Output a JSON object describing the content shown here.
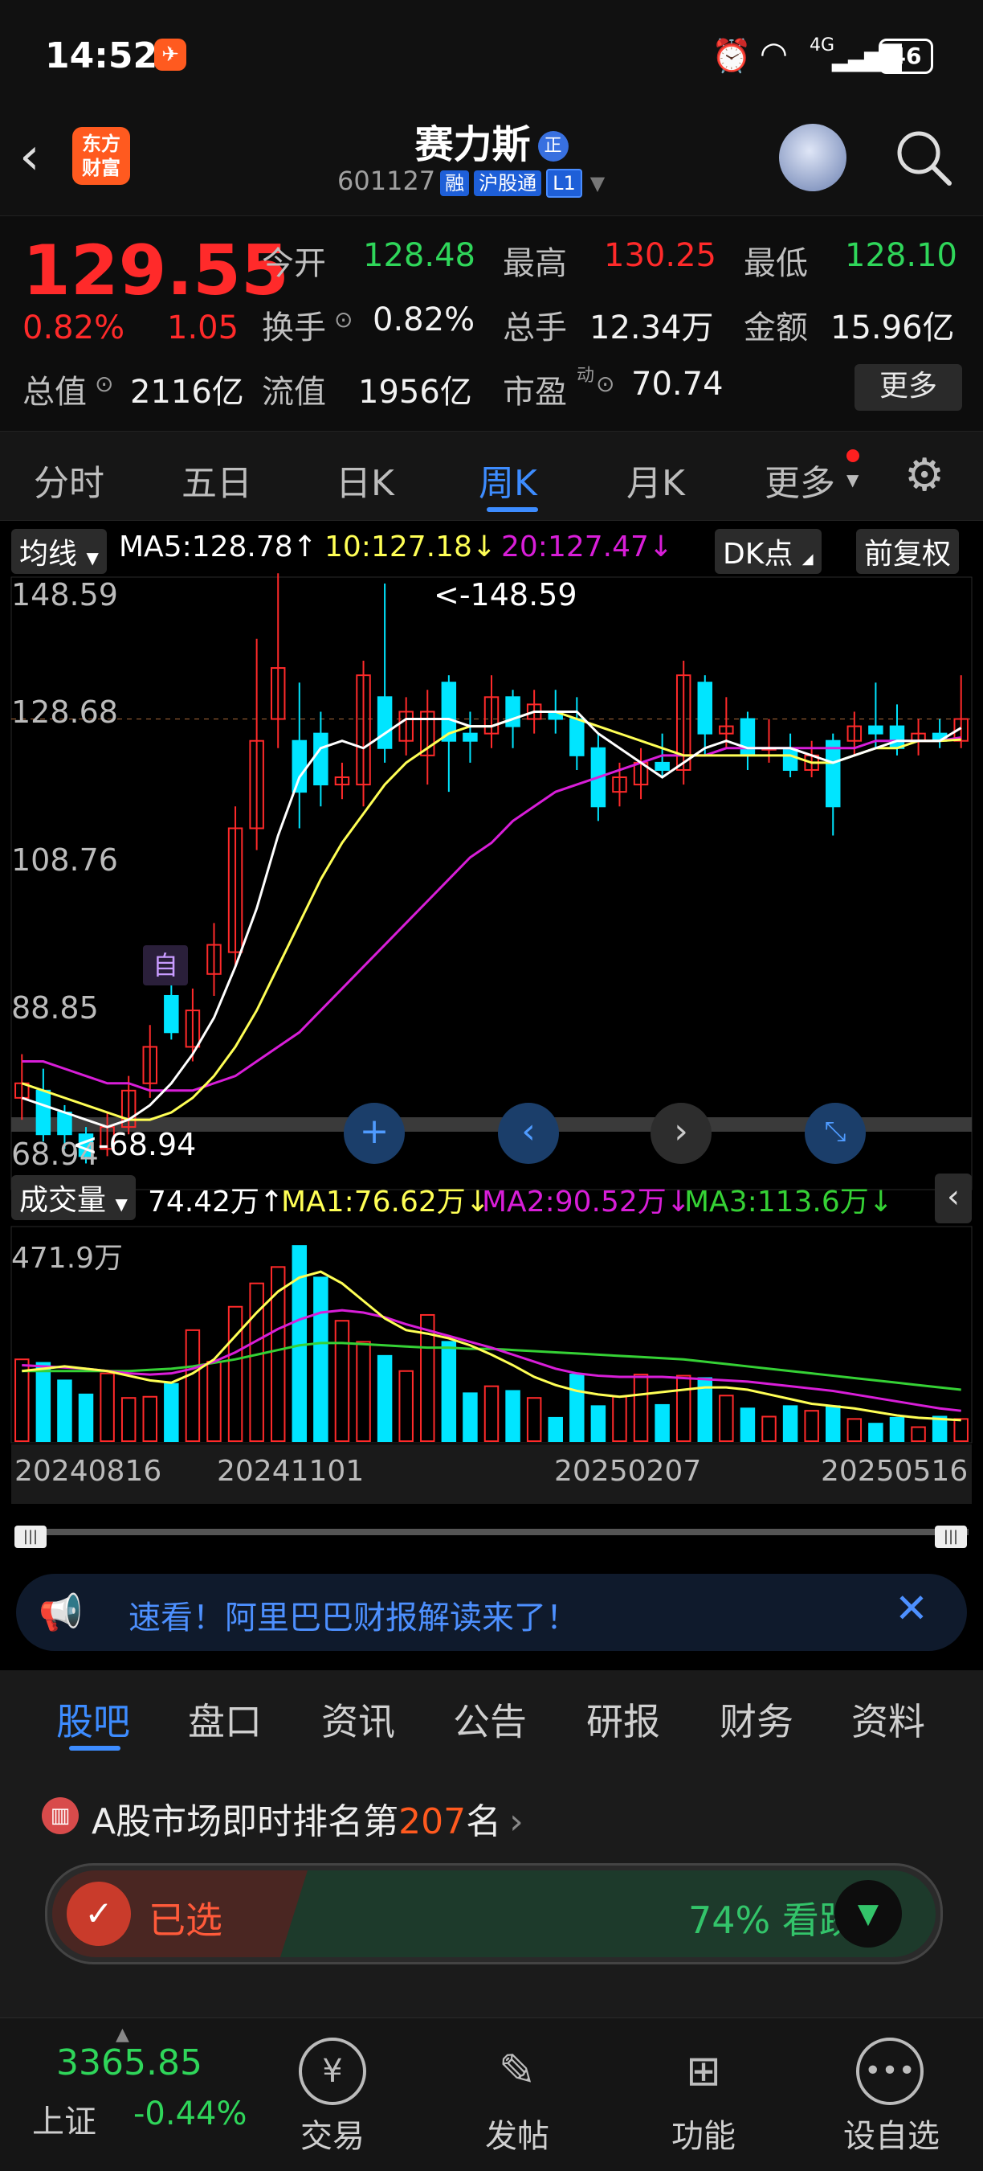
{
  "status_bar": {
    "time": "14:52",
    "network": "4G",
    "battery": "46"
  },
  "header": {
    "logo_line1": "东方",
    "logo_line2": "财富",
    "title": "赛力斯",
    "title_badge": "正",
    "code": "601127",
    "badges": [
      "融",
      "沪股通",
      "L1"
    ]
  },
  "quote": {
    "price": "129.55",
    "change_pct": "0.82%",
    "change": "1.05",
    "open_label": "今开",
    "open": "128.48",
    "high_label": "最高",
    "high": "130.25",
    "low_label": "最低",
    "low": "128.10",
    "turnover_label": "换手",
    "turnover": "0.82%",
    "volume_label": "总手",
    "volume": "12.34万",
    "amount_label": "金额",
    "amount": "15.96亿",
    "mktcap_label": "总值",
    "mktcap": "2116亿",
    "float_label": "流值",
    "float": "1956亿",
    "pe_label": "市盈",
    "pe_sup": "动",
    "pe": "70.74",
    "more_button": "更多"
  },
  "tabs": [
    "分时",
    "五日",
    "日K",
    "周K",
    "月K",
    "更多"
  ],
  "active_tab": "周K",
  "chart": {
    "indicator_select": "均线",
    "ma5": "MA5:128.78↑",
    "ma10": "10:127.18↓",
    "ma20": "20:127.47↓",
    "dk_button": "DK点",
    "fq_button": "前复权",
    "y_labels": [
      "148.59",
      "128.68",
      "108.76",
      "88.85",
      "68.94"
    ],
    "high_note": "<-148.59",
    "low_note": "<-68.94",
    "auto_marker": "自",
    "vol_select": "成交量",
    "vol_value": "74.42万↑",
    "vol_ma1": "MA1:76.62万↓",
    "vol_ma2": "MA2:90.52万↓",
    "vol_ma3": "MA3:113.6万↓",
    "vol_top": "471.9万",
    "dates": [
      "20240816",
      "20241101",
      "20250207",
      "20250516"
    ],
    "colors": {
      "up": "#ff2a2a",
      "down": "#00e5ff",
      "ma5": "#ffffff",
      "ma10": "#ffff55",
      "ma20": "#d81ed8",
      "ma3": "#35d135"
    }
  },
  "chart_data": {
    "type": "candlestick",
    "ylim": [
      68.94,
      148.59
    ],
    "series": [
      {
        "o": 78,
        "c": 80,
        "h": 84,
        "l": 75
      },
      {
        "o": 79,
        "c": 73,
        "h": 82,
        "l": 72
      },
      {
        "o": 76,
        "c": 73,
        "h": 77,
        "l": 71
      },
      {
        "o": 73,
        "c": 70,
        "h": 74,
        "l": 69
      },
      {
        "o": 71,
        "c": 74,
        "h": 76,
        "l": 70
      },
      {
        "o": 74,
        "c": 79,
        "h": 81,
        "l": 73
      },
      {
        "o": 80,
        "c": 85,
        "h": 88,
        "l": 78
      },
      {
        "o": 92,
        "c": 87,
        "h": 95,
        "l": 86
      },
      {
        "o": 85,
        "c": 90,
        "h": 93,
        "l": 83
      },
      {
        "o": 95,
        "c": 99,
        "h": 102,
        "l": 92
      },
      {
        "o": 98,
        "c": 115,
        "h": 118,
        "l": 96
      },
      {
        "o": 115,
        "c": 127,
        "h": 141,
        "l": 112
      },
      {
        "o": 130,
        "c": 137,
        "h": 150,
        "l": 126
      },
      {
        "o": 127,
        "c": 120,
        "h": 135,
        "l": 115
      },
      {
        "o": 128,
        "c": 121,
        "h": 131,
        "l": 118
      },
      {
        "o": 121,
        "c": 122,
        "h": 124,
        "l": 119
      },
      {
        "o": 121,
        "c": 136,
        "h": 138,
        "l": 118
      },
      {
        "o": 133,
        "c": 126,
        "h": 148.59,
        "l": 124
      },
      {
        "o": 127,
        "c": 131,
        "h": 133,
        "l": 125
      },
      {
        "o": 125,
        "c": 131,
        "h": 134,
        "l": 121
      },
      {
        "o": 135,
        "c": 127,
        "h": 136,
        "l": 120
      },
      {
        "o": 128,
        "c": 127,
        "h": 131,
        "l": 124
      },
      {
        "o": 128,
        "c": 133,
        "h": 136,
        "l": 126
      },
      {
        "o": 133,
        "c": 129,
        "h": 134,
        "l": 126
      },
      {
        "o": 130,
        "c": 132,
        "h": 134,
        "l": 128
      },
      {
        "o": 131,
        "c": 130,
        "h": 134,
        "l": 128
      },
      {
        "o": 130,
        "c": 125,
        "h": 133,
        "l": 123
      },
      {
        "o": 126,
        "c": 118,
        "h": 128,
        "l": 116
      },
      {
        "o": 120,
        "c": 122,
        "h": 124,
        "l": 118
      },
      {
        "o": 121,
        "c": 124,
        "h": 126,
        "l": 119
      },
      {
        "o": 124,
        "c": 123,
        "h": 128,
        "l": 122
      },
      {
        "o": 123,
        "c": 136,
        "h": 138,
        "l": 121
      },
      {
        "o": 135,
        "c": 128,
        "h": 136,
        "l": 125
      },
      {
        "o": 128,
        "c": 129,
        "h": 133,
        "l": 126
      },
      {
        "o": 130,
        "c": 125,
        "h": 131,
        "l": 123
      },
      {
        "o": 126,
        "c": 126,
        "h": 130,
        "l": 124
      },
      {
        "o": 126,
        "c": 123,
        "h": 128,
        "l": 122
      },
      {
        "o": 123,
        "c": 125,
        "h": 127,
        "l": 122
      },
      {
        "o": 127,
        "c": 118,
        "h": 128,
        "l": 114
      },
      {
        "o": 127,
        "c": 129,
        "h": 131,
        "l": 125
      },
      {
        "o": 129,
        "c": 128,
        "h": 135,
        "l": 126
      },
      {
        "o": 129,
        "c": 126,
        "h": 132,
        "l": 125
      },
      {
        "o": 127,
        "c": 128,
        "h": 130,
        "l": 125
      },
      {
        "o": 128,
        "c": 127,
        "h": 130,
        "l": 126
      },
      {
        "o": 127,
        "c": 130,
        "h": 136,
        "l": 126
      }
    ],
    "ma5": [
      78,
      77,
      76,
      75,
      74,
      75,
      77,
      80,
      84,
      89,
      96,
      104,
      114,
      122,
      126,
      127,
      126,
      128,
      130,
      130,
      130,
      129,
      129,
      130,
      131,
      131,
      131,
      128,
      126,
      124,
      122,
      124,
      126,
      127,
      126,
      126,
      126,
      125,
      124,
      125,
      126,
      127,
      127,
      127,
      128.78
    ],
    "ma10": [
      80,
      79,
      78,
      77,
      76,
      75,
      75,
      76,
      78,
      81,
      85,
      90,
      96,
      102,
      108,
      113,
      117,
      121,
      124,
      126,
      128,
      129,
      129,
      130,
      131,
      131,
      130,
      129,
      128,
      127,
      126,
      125,
      125,
      125,
      125,
      125,
      125,
      124,
      124,
      125,
      126,
      126,
      127,
      127,
      127.18
    ],
    "ma20": [
      83,
      83,
      82,
      81,
      80,
      80,
      79,
      79,
      79,
      80,
      81,
      83,
      85,
      87,
      90,
      93,
      96,
      99,
      102,
      105,
      108,
      111,
      113,
      116,
      118,
      120,
      121,
      122,
      123,
      124,
      125,
      125,
      125,
      126,
      126,
      126,
      126,
      126,
      126,
      126,
      127,
      127,
      127,
      127,
      127.47
    ],
    "volume": [
      70,
      67,
      52,
      40,
      58,
      37,
      38,
      49,
      95,
      68,
      115,
      135,
      149,
      167,
      140,
      103,
      85,
      73,
      60,
      108,
      85,
      41,
      47,
      43,
      37,
      20,
      57,
      30,
      38,
      57,
      31,
      56,
      54,
      39,
      28,
      21,
      30,
      26,
      30,
      19,
      15,
      20,
      12,
      21,
      19
    ],
    "vol_ma1": [
      60,
      62,
      64,
      62,
      60,
      56,
      52,
      50,
      58,
      70,
      90,
      110,
      128,
      140,
      145,
      135,
      120,
      105,
      95,
      92,
      88,
      82,
      74,
      65,
      55,
      48,
      43,
      40,
      38,
      40,
      42,
      44,
      46,
      46,
      44,
      40,
      36,
      32,
      30,
      28,
      25,
      22,
      20,
      19,
      18
    ],
    "vol_ma2": [
      65,
      64,
      63,
      62,
      60,
      58,
      57,
      58,
      62,
      68,
      76,
      86,
      96,
      104,
      110,
      112,
      110,
      106,
      100,
      95,
      90,
      85,
      80,
      74,
      68,
      62,
      58,
      56,
      55,
      55,
      55,
      54,
      53,
      52,
      51,
      49,
      47,
      45,
      43,
      40,
      37,
      34,
      31,
      28,
      26
    ],
    "vol_ma3": [
      60,
      60,
      60,
      60,
      60,
      60,
      61,
      62,
      64,
      67,
      70,
      74,
      78,
      82,
      84,
      84,
      83,
      82,
      81,
      80,
      80,
      79,
      79,
      78,
      77,
      76,
      75,
      74,
      73,
      72,
      71,
      70,
      68,
      66,
      64,
      62,
      60,
      58,
      56,
      54,
      52,
      50,
      48,
      46,
      44
    ]
  },
  "banner": {
    "text": "速看！阿里巴巴财报解读来了！"
  },
  "bottom_tabs": [
    "股吧",
    "盘口",
    "资讯",
    "公告",
    "研报",
    "财务",
    "资料"
  ],
  "active_bottom_tab": "股吧",
  "rank": {
    "prefix": "A股市场即时排名第",
    "num": "207",
    "suffix": "名",
    "selected": "已选",
    "bear": "74% 看跌",
    "bear_pct": 74
  },
  "footer": {
    "index_value": "3365.85",
    "index_name": "上证",
    "index_change": "-0.44%",
    "items": [
      "交易",
      "发帖",
      "功能",
      "设自选"
    ]
  }
}
